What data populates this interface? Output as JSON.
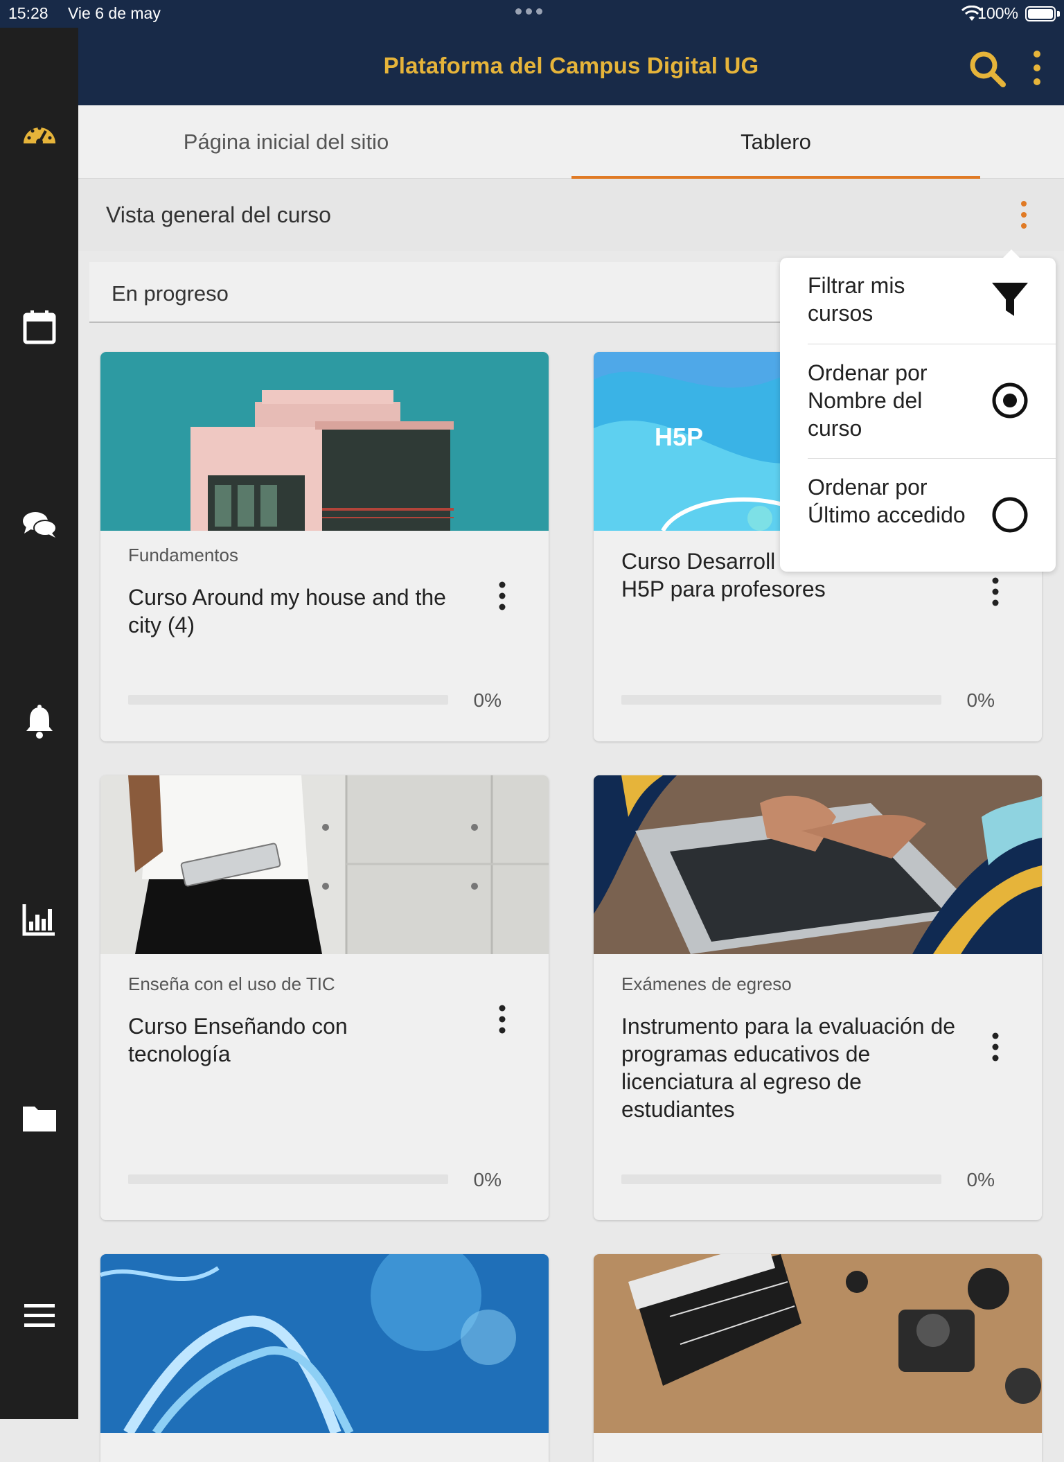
{
  "status_bar": {
    "time": "15:28",
    "date": "Vie 6 de may",
    "battery": "100%"
  },
  "header": {
    "title": "Plataforma del Campus Digital UG"
  },
  "tabs": [
    {
      "label": "Página inicial del sitio"
    },
    {
      "label": "Tablero"
    }
  ],
  "active_tab": "Tablero",
  "overview": {
    "title": "Vista general del curso"
  },
  "filter": {
    "selected": "En progreso"
  },
  "menu": {
    "items": [
      {
        "label": "Filtrar mis cursos",
        "icon": "filter-icon"
      },
      {
        "label": "Ordenar por Nombre del curso",
        "icon": "radio-selected-icon",
        "selected": true
      },
      {
        "label": "Ordenar por Último accedido",
        "icon": "radio-unselected-icon",
        "selected": false
      }
    ]
  },
  "sidebar": {
    "icons": [
      "dashboard-icon",
      "calendar-icon",
      "messages-icon",
      "notifications-icon",
      "grades-icon",
      "files-icon",
      "menu-icon"
    ]
  },
  "courses": [
    {
      "category": "Fundamentos",
      "name": "Curso Around my house and the city (4)",
      "progress": 0,
      "progress_label": "0%"
    },
    {
      "category": "",
      "name": "Curso Desarrollo de recursos didácticos con H5P para profesores",
      "visible_name": "Curso Desarroll didácticos con H5P para profesores",
      "image_text": "H5P",
      "progress": 0,
      "progress_label": "0%"
    },
    {
      "category": "Enseña con el uso de TIC",
      "name": "Curso Enseñando con tecnología",
      "progress": 0,
      "progress_label": "0%"
    },
    {
      "category": "Exámenes de egreso",
      "name": "Instrumento para la evaluación de programas educativos de licenciatura al egreso de estudiantes",
      "progress": 0,
      "progress_label": "0%"
    }
  ],
  "colors": {
    "header_bg": "#182a48",
    "title_gold": "#e6b43a",
    "accent_orange": "#e07a25",
    "sidebar_bg": "#1f1f1f"
  }
}
